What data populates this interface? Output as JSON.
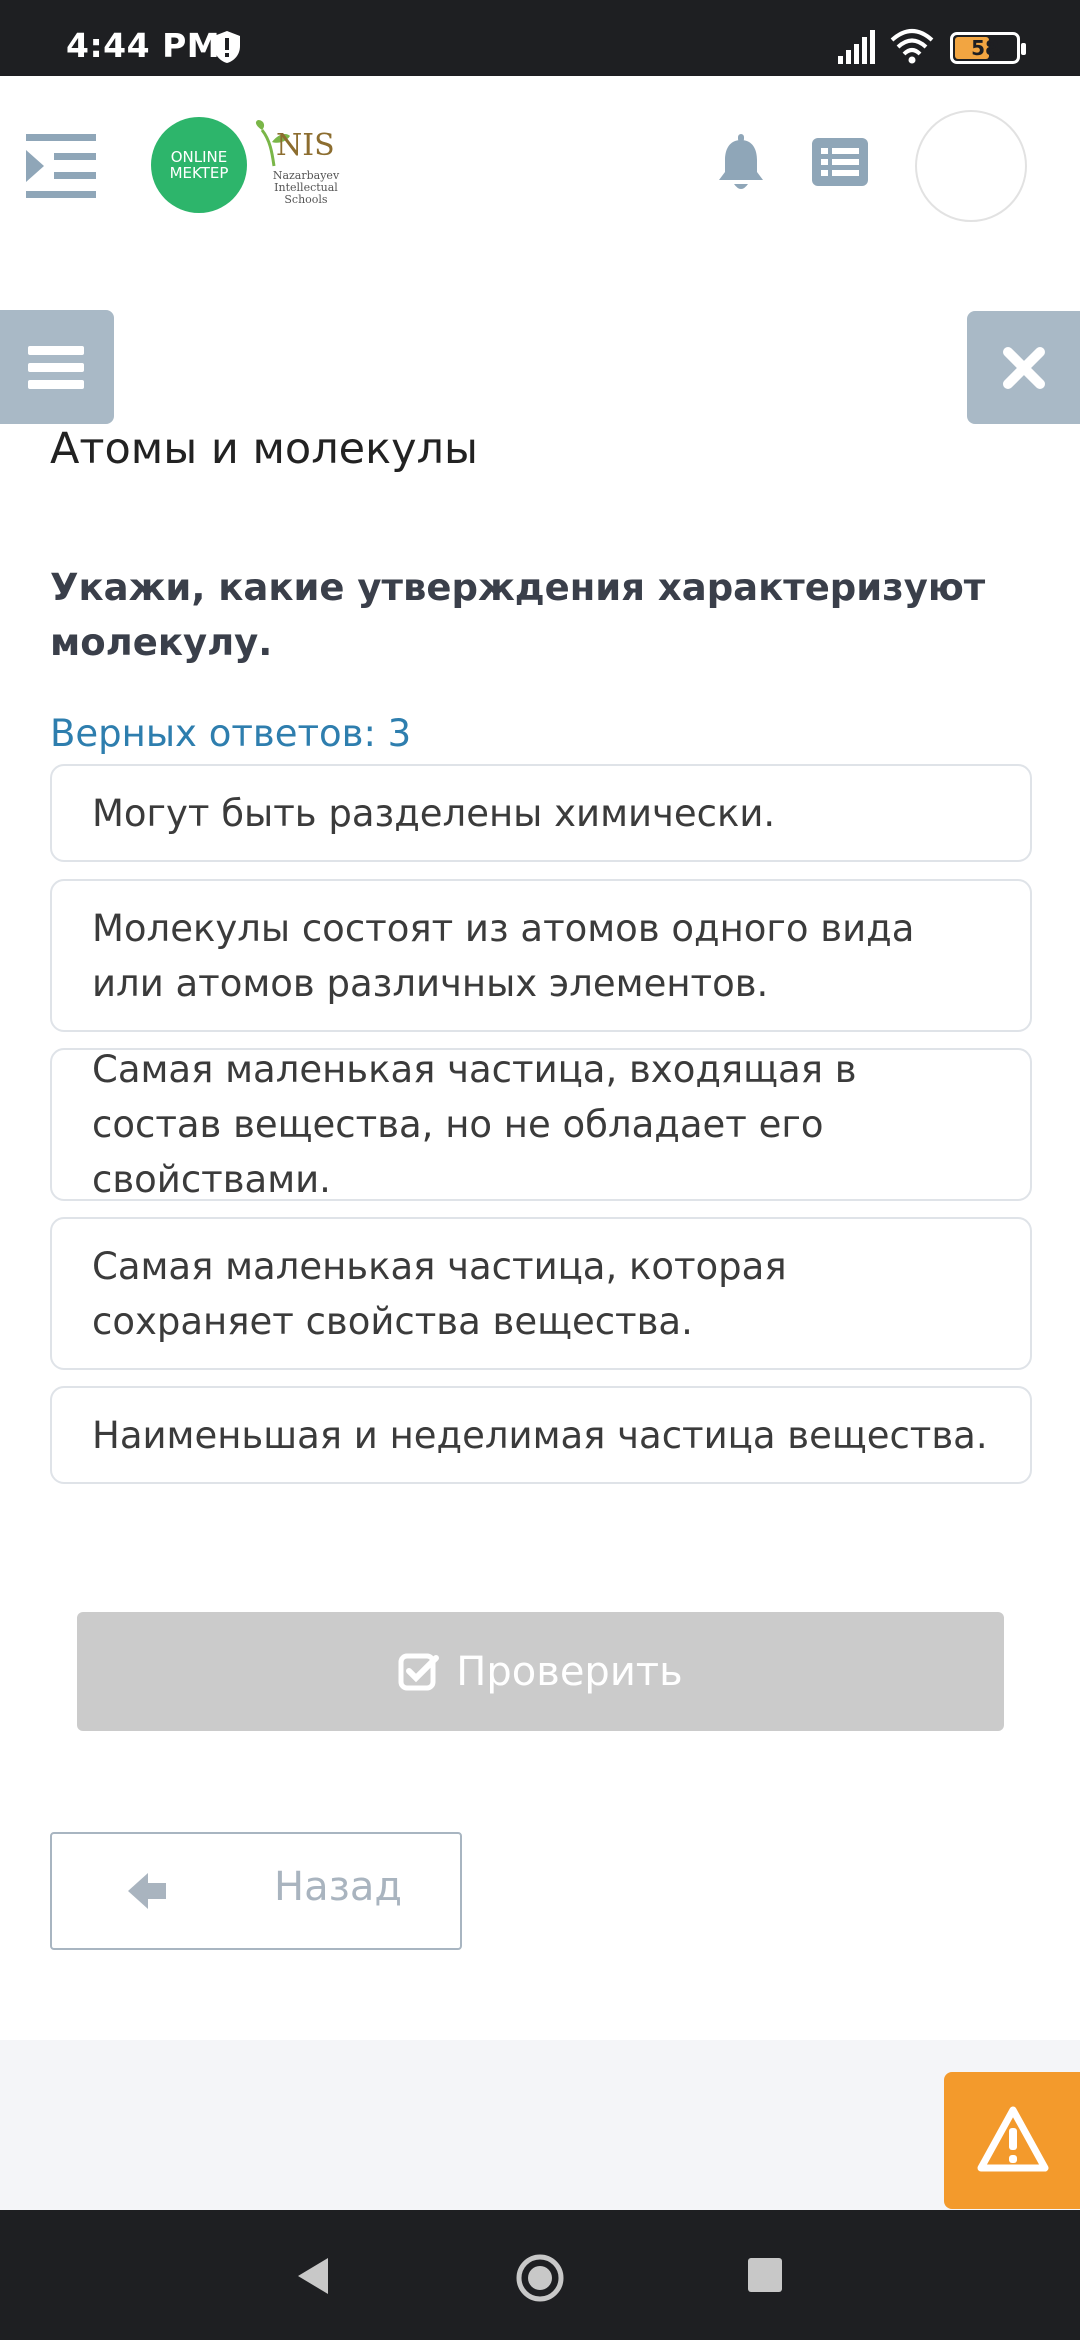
{
  "status_bar": {
    "time": "4:44 PM",
    "battery": "58"
  },
  "header": {
    "logo_text": "ONLINE MEKTEP",
    "nis_word": "NIS",
    "nis_subtitle": "Nazarbayev Intellectual Schools"
  },
  "lesson": {
    "title": "Атомы и молекулы"
  },
  "question": {
    "text": "Укажи, какие утверждения характеризуют молекулу.",
    "answers_count": "Верных ответов: 3",
    "options": [
      "Могут быть разделены химически.",
      "Молекулы состоят из атомов одного вида или атомов различных элементов.",
      "Самая маленькая частица, входящая в состав вещества, но не обладает его свойствами.",
      "Самая маленькая частица, которая сохраняет свойства вещества.",
      "Наименьшая и неделимая частица вещества."
    ]
  },
  "actions": {
    "check_label": "Проверить",
    "back_label": "Назад"
  },
  "colors": {
    "accent_blue": "#2e7eae",
    "side_button": "#a9b9c6",
    "warning": "#f39a2c",
    "logo_green": "#2db56b"
  }
}
